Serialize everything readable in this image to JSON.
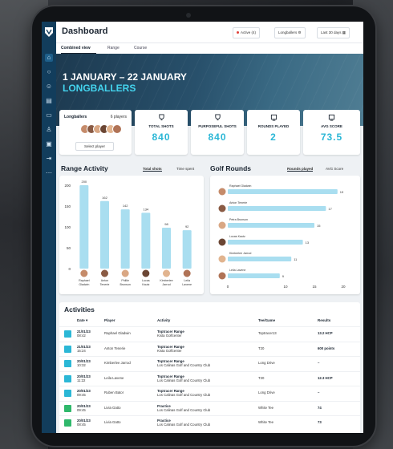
{
  "app": {
    "title": "Dashboard"
  },
  "header": {
    "active_label": "Active (4)",
    "group_select": "Longballers",
    "range_select": "Last 30 days"
  },
  "tabs": [
    {
      "label": "Combined view",
      "active": true
    },
    {
      "label": "Range",
      "active": false
    },
    {
      "label": "Course",
      "active": false
    }
  ],
  "hero": {
    "date_range": "1 JANUARY – 22 JANUARY",
    "group_name": "LONGBALLERS"
  },
  "longballers": {
    "title": "Longballers",
    "count": "6 players",
    "select_label": "Select player"
  },
  "stats": [
    {
      "icon": "trophy-icon",
      "label": "TOTAL SHOTS",
      "value": "840"
    },
    {
      "icon": "trophy-icon",
      "label": "PURPOSEFUL SHOTS",
      "value": "840"
    },
    {
      "icon": "flag-icon",
      "label": "ROUNDS PLAYED",
      "value": "2"
    },
    {
      "icon": "flag-icon",
      "label": "AVG SCORE",
      "value": "73.5"
    }
  ],
  "range_activity": {
    "title": "Range Activity",
    "toggles": [
      "Total shots",
      "Time spent"
    ],
    "active_toggle": "Total shots"
  },
  "golf_rounds": {
    "title": "Golf Rounds",
    "toggles": [
      "Rounds played",
      "AVG Score"
    ],
    "active_toggle": "Rounds played"
  },
  "chart_data": [
    {
      "type": "bar",
      "title": "Range Activity",
      "categories": [
        "Raphael Gladwin",
        "Anton Tenerie",
        "Phillie Brunson",
        "Lucas Kautz",
        "Kimberlee Jarrod",
        "Leila Lavene"
      ],
      "values": [
        200,
        162,
        142,
        134,
        98,
        92
      ],
      "ylim": [
        0,
        200
      ],
      "yticks": [
        "200",
        "150",
        "100",
        "50",
        "0"
      ]
    },
    {
      "type": "bar",
      "orientation": "horizontal",
      "title": "Golf Rounds",
      "categories": [
        "Raphael Gladwin",
        "Anton Tenerie",
        "Petra Brunson",
        "Lucas Kautz",
        "Kimberlee Jarrod",
        "Leila Lavene"
      ],
      "values": [
        19,
        17,
        15,
        13,
        11,
        9
      ],
      "xlim": [
        0,
        20
      ],
      "xticks": [
        "0",
        "10",
        "15",
        "20"
      ]
    }
  ],
  "activities": {
    "title": "Activities",
    "headers": [
      "Date",
      "Player",
      "Activity",
      "Tee/Game",
      "Results"
    ],
    "rows": [
      {
        "color": "#2bb7d6",
        "date": "21/01/23",
        "time": "08:42",
        "player": "Raphael Gladwin",
        "activity": "Toptracer Range",
        "location": "Kista Golfcenter",
        "tee": "Toptracer13",
        "result": "13.2 HCP"
      },
      {
        "color": "#2bb7d6",
        "date": "21/01/23",
        "time": "15:24",
        "player": "Anton Tenerie",
        "activity": "Toptracer Range",
        "location": "Kista Golfcenter",
        "tee": "T20",
        "result": "600 points"
      },
      {
        "color": "#2bb7d6",
        "date": "20/01/23",
        "time": "10:32",
        "player": "Kimberlee Jarrod",
        "activity": "Toptracer Range",
        "location": "Los Calinas Golf and Country Club",
        "tee": "Long Drive",
        "result": "–"
      },
      {
        "color": "#2bb7d6",
        "date": "20/01/23",
        "time": "11:22",
        "player": "Leila Lavene",
        "activity": "Toptracer Range",
        "location": "Los Calinas Golf and Country Club",
        "tee": "T20",
        "result": "12.3 HCP"
      },
      {
        "color": "#2bb7d6",
        "date": "20/01/23",
        "time": "09:45",
        "player": "Ruben Bator",
        "activity": "Toptracer Range",
        "location": "Los Calinas Golf and Country Club",
        "tee": "Long Drive",
        "result": "–"
      },
      {
        "color": "#2fb86b",
        "date": "20/01/23",
        "time": "09:45",
        "player": "Livia Gatto",
        "activity": "Practice",
        "location": "Los Calinas Golf and Country Club",
        "tee": "White Tee",
        "result": "74"
      },
      {
        "color": "#2fb86b",
        "date": "20/01/23",
        "time": "08:45",
        "player": "Livia Gatto",
        "activity": "Practice",
        "location": "Los Calinas Golf and Country Club",
        "tee": "White Tee",
        "result": "73"
      }
    ]
  }
}
